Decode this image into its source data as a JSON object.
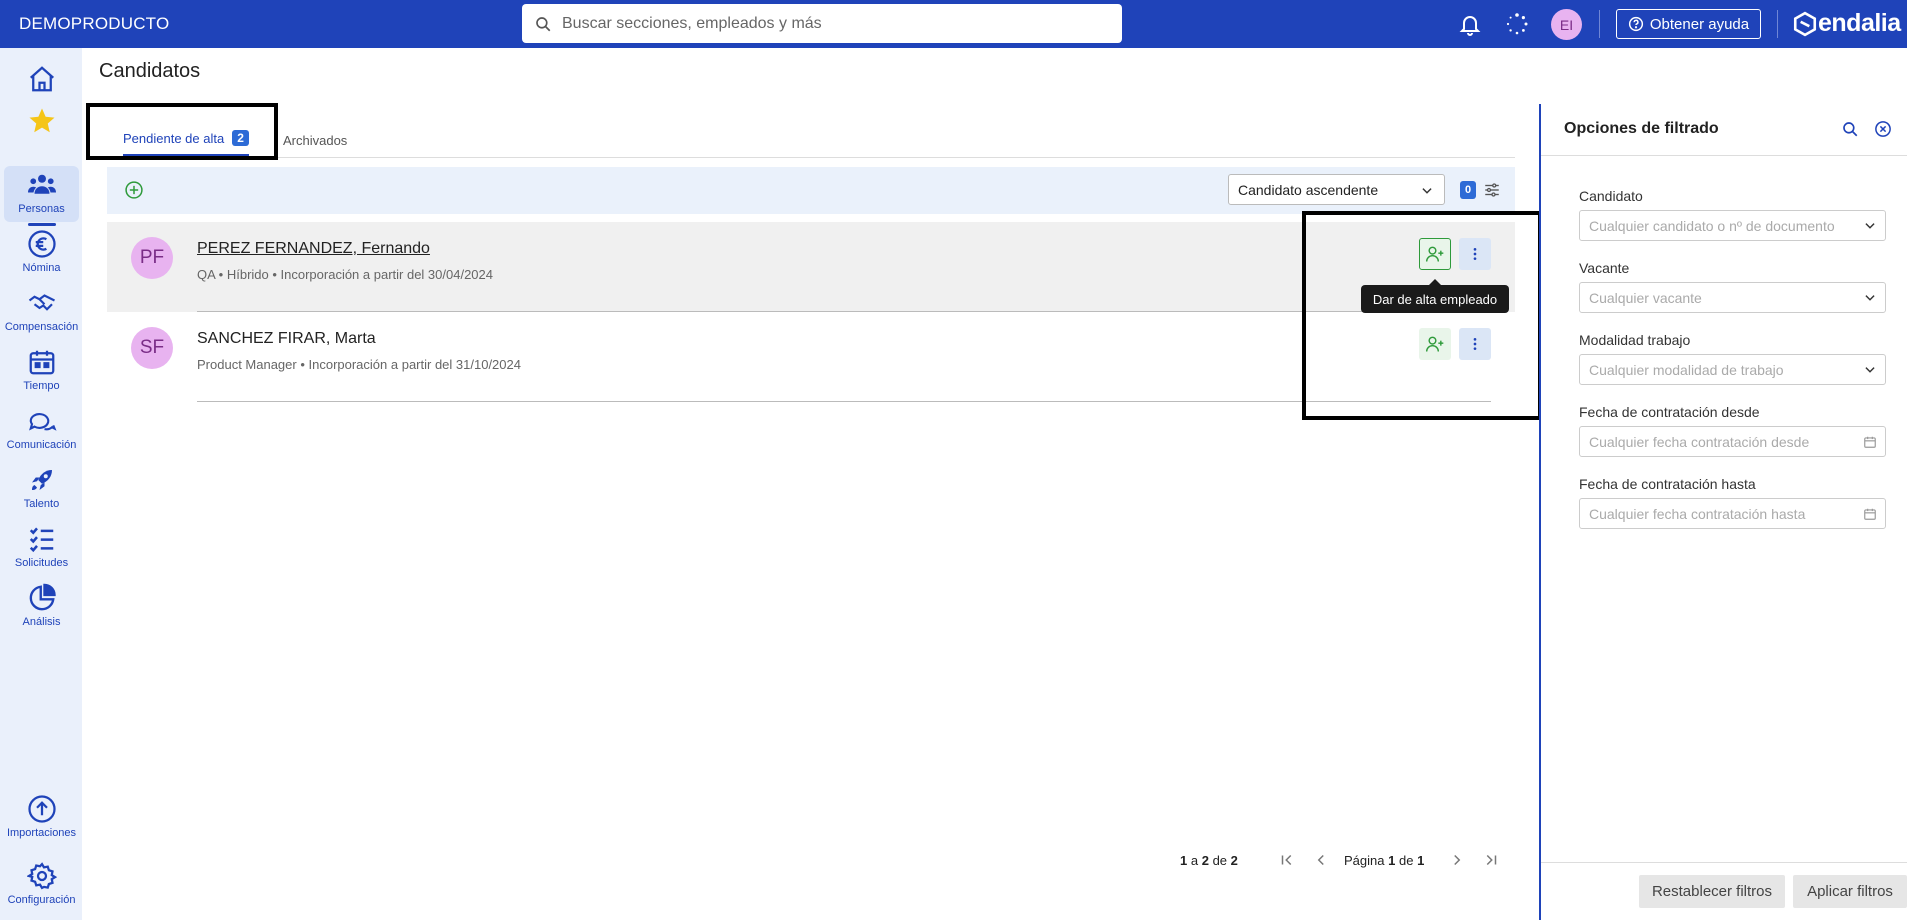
{
  "topbar": {
    "company": "DEMOPRODUCTO",
    "search_placeholder": "Buscar secciones, empleados y más",
    "user_initials": "EI",
    "help_label": "Obtener ayuda",
    "brand": "endalia"
  },
  "sidebar": {
    "items": [
      {
        "label": "Personas"
      },
      {
        "label": "Nómina"
      },
      {
        "label": "Compensación"
      },
      {
        "label": "Tiempo"
      },
      {
        "label": "Comunicación"
      },
      {
        "label": "Talento"
      },
      {
        "label": "Solicitudes"
      },
      {
        "label": "Análisis"
      },
      {
        "label": "Importaciones"
      },
      {
        "label": "Configuración"
      }
    ]
  },
  "page": {
    "title": "Candidatos",
    "tabs": [
      {
        "label": "Pendiente de alta",
        "badge": "2"
      },
      {
        "label": "Archivados"
      }
    ]
  },
  "toolbar": {
    "sort_value": "Candidato ascendente",
    "filter_count": "0"
  },
  "candidates": [
    {
      "initials": "PF",
      "name": "PEREZ FERNANDEZ, Fernando",
      "details": "QA • Híbrido • Incorporación a partir del 30/04/2024"
    },
    {
      "initials": "SF",
      "name": "SANCHEZ FIRAR, Marta",
      "details": "Product Manager • Incorporación a partir del 31/10/2024"
    }
  ],
  "tooltip": "Dar de alta empleado",
  "pagination": {
    "from": "1",
    "to_word": "a",
    "to": "2",
    "of_word": "de",
    "total": "2",
    "page_word": "Página",
    "page": "1",
    "page_of_word": "de",
    "pages": "1"
  },
  "filters": {
    "title": "Opciones de filtrado",
    "fields": [
      {
        "label": "Candidato",
        "placeholder": "Cualquier candidato o nº de documento"
      },
      {
        "label": "Vacante",
        "placeholder": "Cualquier vacante"
      },
      {
        "label": "Modalidad trabajo",
        "placeholder": "Cualquier modalidad de trabajo"
      },
      {
        "label": "Fecha de contratación desde",
        "placeholder": "Cualquier fecha contratación desde"
      },
      {
        "label": "Fecha de contratación hasta",
        "placeholder": "Cualquier fecha contratación hasta"
      }
    ],
    "reset_label": "Restablecer filtros",
    "apply_label": "Aplicar filtros"
  },
  "colors": {
    "primary": "#1f43b9",
    "sidebar_bg": "#eaf0fb",
    "avatar_bg": "#e8b3f0",
    "hire_green": "#2e9a3a"
  }
}
